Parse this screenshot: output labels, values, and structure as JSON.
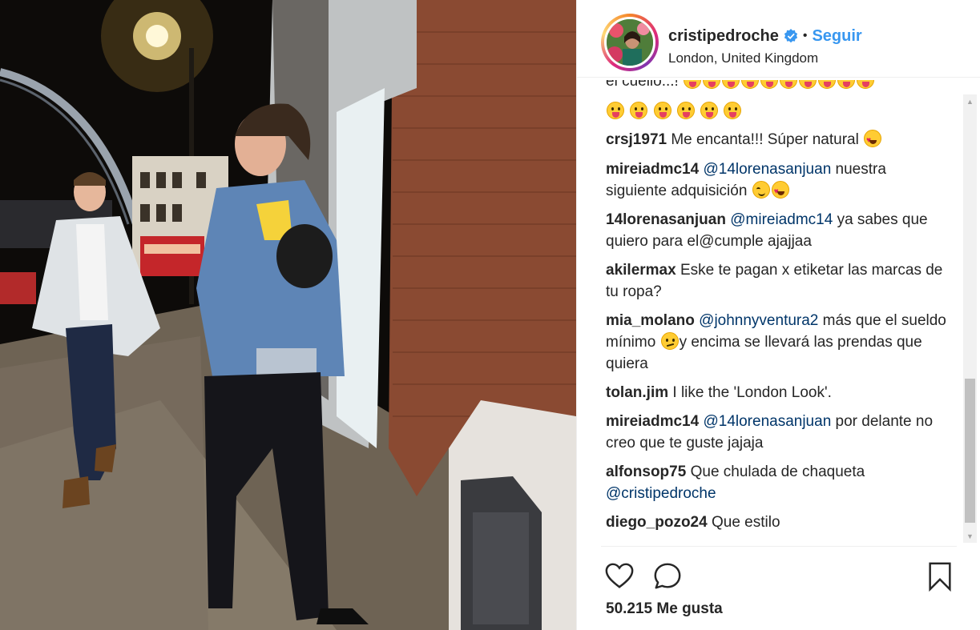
{
  "post": {
    "username": "cristipedroche",
    "separator": "•",
    "follow_label": "Seguir",
    "location": "London, United Kingdom"
  },
  "comments": [
    {
      "user": "",
      "parts": [
        {
          "t": "el cuello...!"
        }
      ]
    },
    {
      "user": "",
      "parts": []
    },
    {
      "user": "crsj1971",
      "parts": [
        {
          "t": "Me encanta!!! Súper natural"
        }
      ]
    },
    {
      "user": "mireiadmc14",
      "parts": [
        {
          "mention": "@14lorenasanjuan"
        },
        {
          "t": "nuestra siguiente adquisición"
        }
      ]
    },
    {
      "user": "14lorenasanjuan",
      "parts": [
        {
          "mention": "@mireiadmc14"
        },
        {
          "t": "ya sabes que quiero para el@cumple ajajjaa"
        }
      ]
    },
    {
      "user": "akilermax",
      "parts": [
        {
          "t": "Eske te pagan x etiketar las marcas de tu ropa?"
        }
      ]
    },
    {
      "user": "mia_molano",
      "parts": [
        {
          "mention": "@johnnyventura2"
        },
        {
          "t": "más que el sueldo mínimo"
        },
        {
          "t": "y encima se llevará las prendas que quiera"
        }
      ]
    },
    {
      "user": "tolan.jim",
      "parts": [
        {
          "t": "I like the 'London Look'."
        }
      ]
    },
    {
      "user": "mireiadmc14",
      "parts": [
        {
          "mention": "@14lorenasanjuan"
        },
        {
          "t": "por delante no creo que te guste jajaja"
        }
      ]
    },
    {
      "user": "alfonsop75",
      "parts": [
        {
          "t": "Que chulada de chaqueta"
        },
        {
          "mention": "@cristipedroche"
        }
      ]
    },
    {
      "user": "diego_pozo24",
      "parts": [
        {
          "t": "Que estilo"
        }
      ]
    }
  ],
  "likes_text": "50.215 Me gusta",
  "icons": {
    "like": "heart-icon",
    "comment": "comment-bubble-icon",
    "save": "bookmark-icon",
    "verified": "verified-badge-icon"
  },
  "colors": {
    "link": "#003569",
    "follow": "#3897f0",
    "verified": "#3897f0"
  }
}
